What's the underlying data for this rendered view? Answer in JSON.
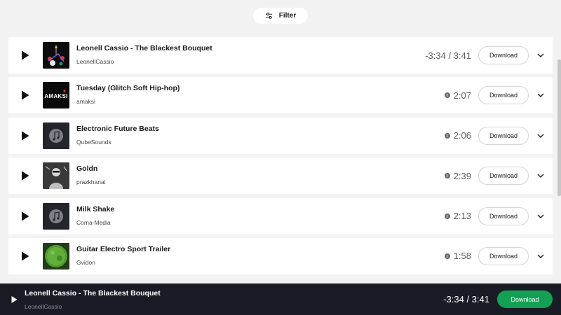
{
  "filter": {
    "label": "Filter",
    "icon": "sliders-icon"
  },
  "tracks": [
    {
      "title": "Leonell Cassio - The Blackest Bouquet",
      "artist": "LeonellCassio",
      "duration": "-3:34 / 3:41",
      "download_label": "Download",
      "playing": true
    },
    {
      "title": "Tuesday (Glitch Soft Hip-hop)",
      "artist": "amaksi",
      "duration": "2:07",
      "download_label": "Download"
    },
    {
      "title": "Electronic Future Beats",
      "artist": "QubeSounds",
      "duration": "2:06",
      "download_label": "Download"
    },
    {
      "title": "Goldn",
      "artist": "prazkhanal",
      "duration": "2:39",
      "download_label": "Download"
    },
    {
      "title": "Milk Shake",
      "artist": "Coma-Media",
      "duration": "2:13",
      "download_label": "Download"
    },
    {
      "title": "Guitar Electro Sport Trailer",
      "artist": "Gvidon",
      "duration": "1:58",
      "download_label": "Download"
    }
  ],
  "player": {
    "title": "Leonell Cassio - The Blackest Bouquet",
    "artist": "LeonellCassio",
    "time": "-3:34 / 3:41",
    "download_label": "Download"
  },
  "thumb_text": {
    "amaksi": "AMAKSI"
  },
  "colors": {
    "page_bg": "#f2f2f2",
    "player_bg": "#191c25",
    "accent_green": "#13a055"
  }
}
